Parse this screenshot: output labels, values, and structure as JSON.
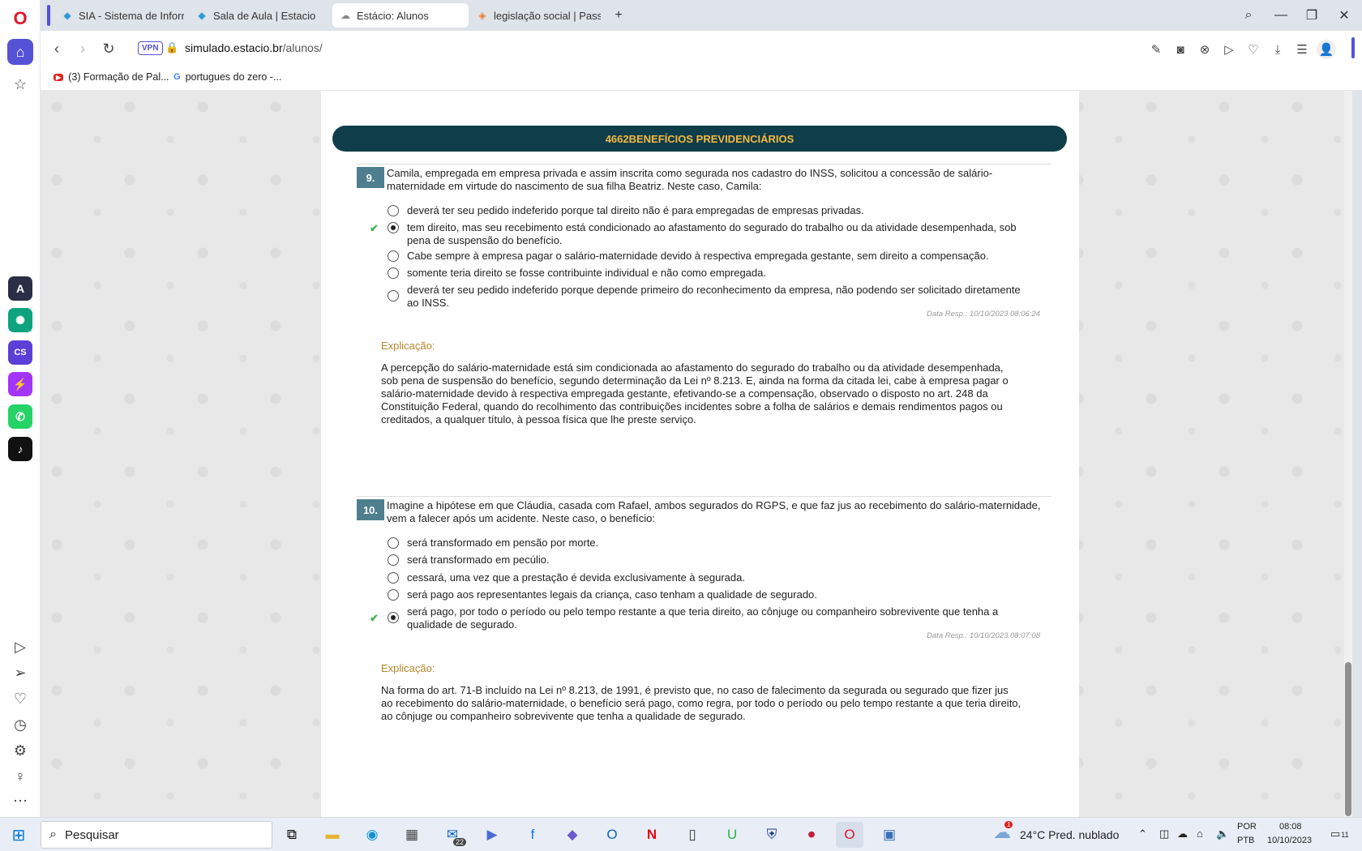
{
  "browser": {
    "tabs": [
      {
        "label": "SIA - Sistema de Informaç",
        "icon": "diamond-icon"
      },
      {
        "label": "Sala de Aula | Estacio",
        "icon": "diamond-icon"
      },
      {
        "label": "Estácio: Alunos",
        "icon": "estacio-icon",
        "active": true
      },
      {
        "label": "legislação social | Passei D",
        "icon": "passei-direto-icon"
      }
    ],
    "vpn_label": "VPN",
    "url_domain": "simulado.estacio.br",
    "url_path": "/alunos/",
    "bookmarks": [
      {
        "label": "(3) Formação de Pal...",
        "icon": "youtube-icon"
      },
      {
        "label": "portugues do zero -...",
        "icon": "google-icon"
      }
    ]
  },
  "page": {
    "banner": "4662BENEFÍCIOS PREVIDENCIÁRIOS",
    "questions": [
      {
        "number": "9.",
        "text": "Camila, empregada em empresa privada e assim inscrita como segurada nos cadastro do INSS, solicitou a concessão de salário-maternidade em virtude do nascimento de sua filha Beatriz. Neste caso, Camila:",
        "options": [
          "deverá ter seu pedido indeferido porque tal direito não é para empregadas de empresas privadas.",
          "tem direito, mas seu recebimento está condicionado ao afastamento do segurado do trabalho ou da atividade desempenhada, sob pena de suspensão do benefício.",
          "Cabe sempre à empresa pagar o salário-maternidade devido à respectiva empregada gestante, sem direito a compensação.",
          "somente teria direito se fosse contribuinte individual e não como empregada.",
          "deverá ter seu pedido indeferido porque depende primeiro do reconhecimento da empresa, não podendo ser solicitado diretamente ao INSS."
        ],
        "selected": 1,
        "date": "Data Resp.: 10/10/2023 08:06:24",
        "explanation_title": "Explicação:",
        "explanation": "A percepção do salário-maternidade está sim condicionada ao afastamento do segurado do trabalho ou da atividade desempenhada, sob pena de suspensão do benefício, segundo determinação da Lei nº 8.213. E, ainda na forma da citada lei, cabe à empresa pagar o salário-maternidade devido à respectiva empregada gestante, efetivando-se a compensação, observado o disposto no art. 248 da Constituição Federal, quando do recolhimento das contribuições incidentes sobre a folha de salários e demais rendimentos pagos ou creditados, a qualquer título, à pessoa física que lhe preste serviço."
      },
      {
        "number": "10.",
        "text": "Imagine a hipótese em que Cláudia, casada com Rafael, ambos segurados do RGPS, e que faz jus ao recebimento do salário-maternidade, vem a falecer após um acidente. Neste caso, o benefício:",
        "options": [
          "será transformado em pensão por morte.",
          "será transformado em pecúlio.",
          "cessará, uma vez que a prestação é devida exclusivamente à segurada.",
          "será pago aos representantes legais da criança, caso tenham a qualidade de segurado.",
          "será pago, por todo o período ou pelo tempo restante a que teria direito, ao cônjuge ou companheiro sobrevivente que tenha a qualidade de segurado."
        ],
        "selected": 4,
        "date": "Data Resp.: 10/10/2023 08:07:08",
        "explanation_title": "Explicação:",
        "explanation": "Na forma do art. 71-B incluído na Lei nº 8.213, de 1991, é previsto que, no caso de falecimento da segurada ou segurado que fizer jus ao recebimento do salário-maternidade, o benefício será pago, como regra, por todo o período ou pelo tempo restante a que teria direito, ao cônjuge ou companheiro sobrevivente que tenha a qualidade de segurado."
      }
    ]
  },
  "taskbar": {
    "search_placeholder": "Pesquisar",
    "mail_badge": "22",
    "weather": "24°C  Pred. nublado",
    "weather_alert": "1",
    "lang_top": "POR",
    "lang_bottom": "PTB",
    "time": "08:08",
    "date": "10/10/2023",
    "notif_count": "11"
  },
  "colors": {
    "banner_bg": "#0f3d4a",
    "banner_text": "#f4b942",
    "qnum_bg": "#4f7f8e",
    "accent": "#5552d8"
  }
}
